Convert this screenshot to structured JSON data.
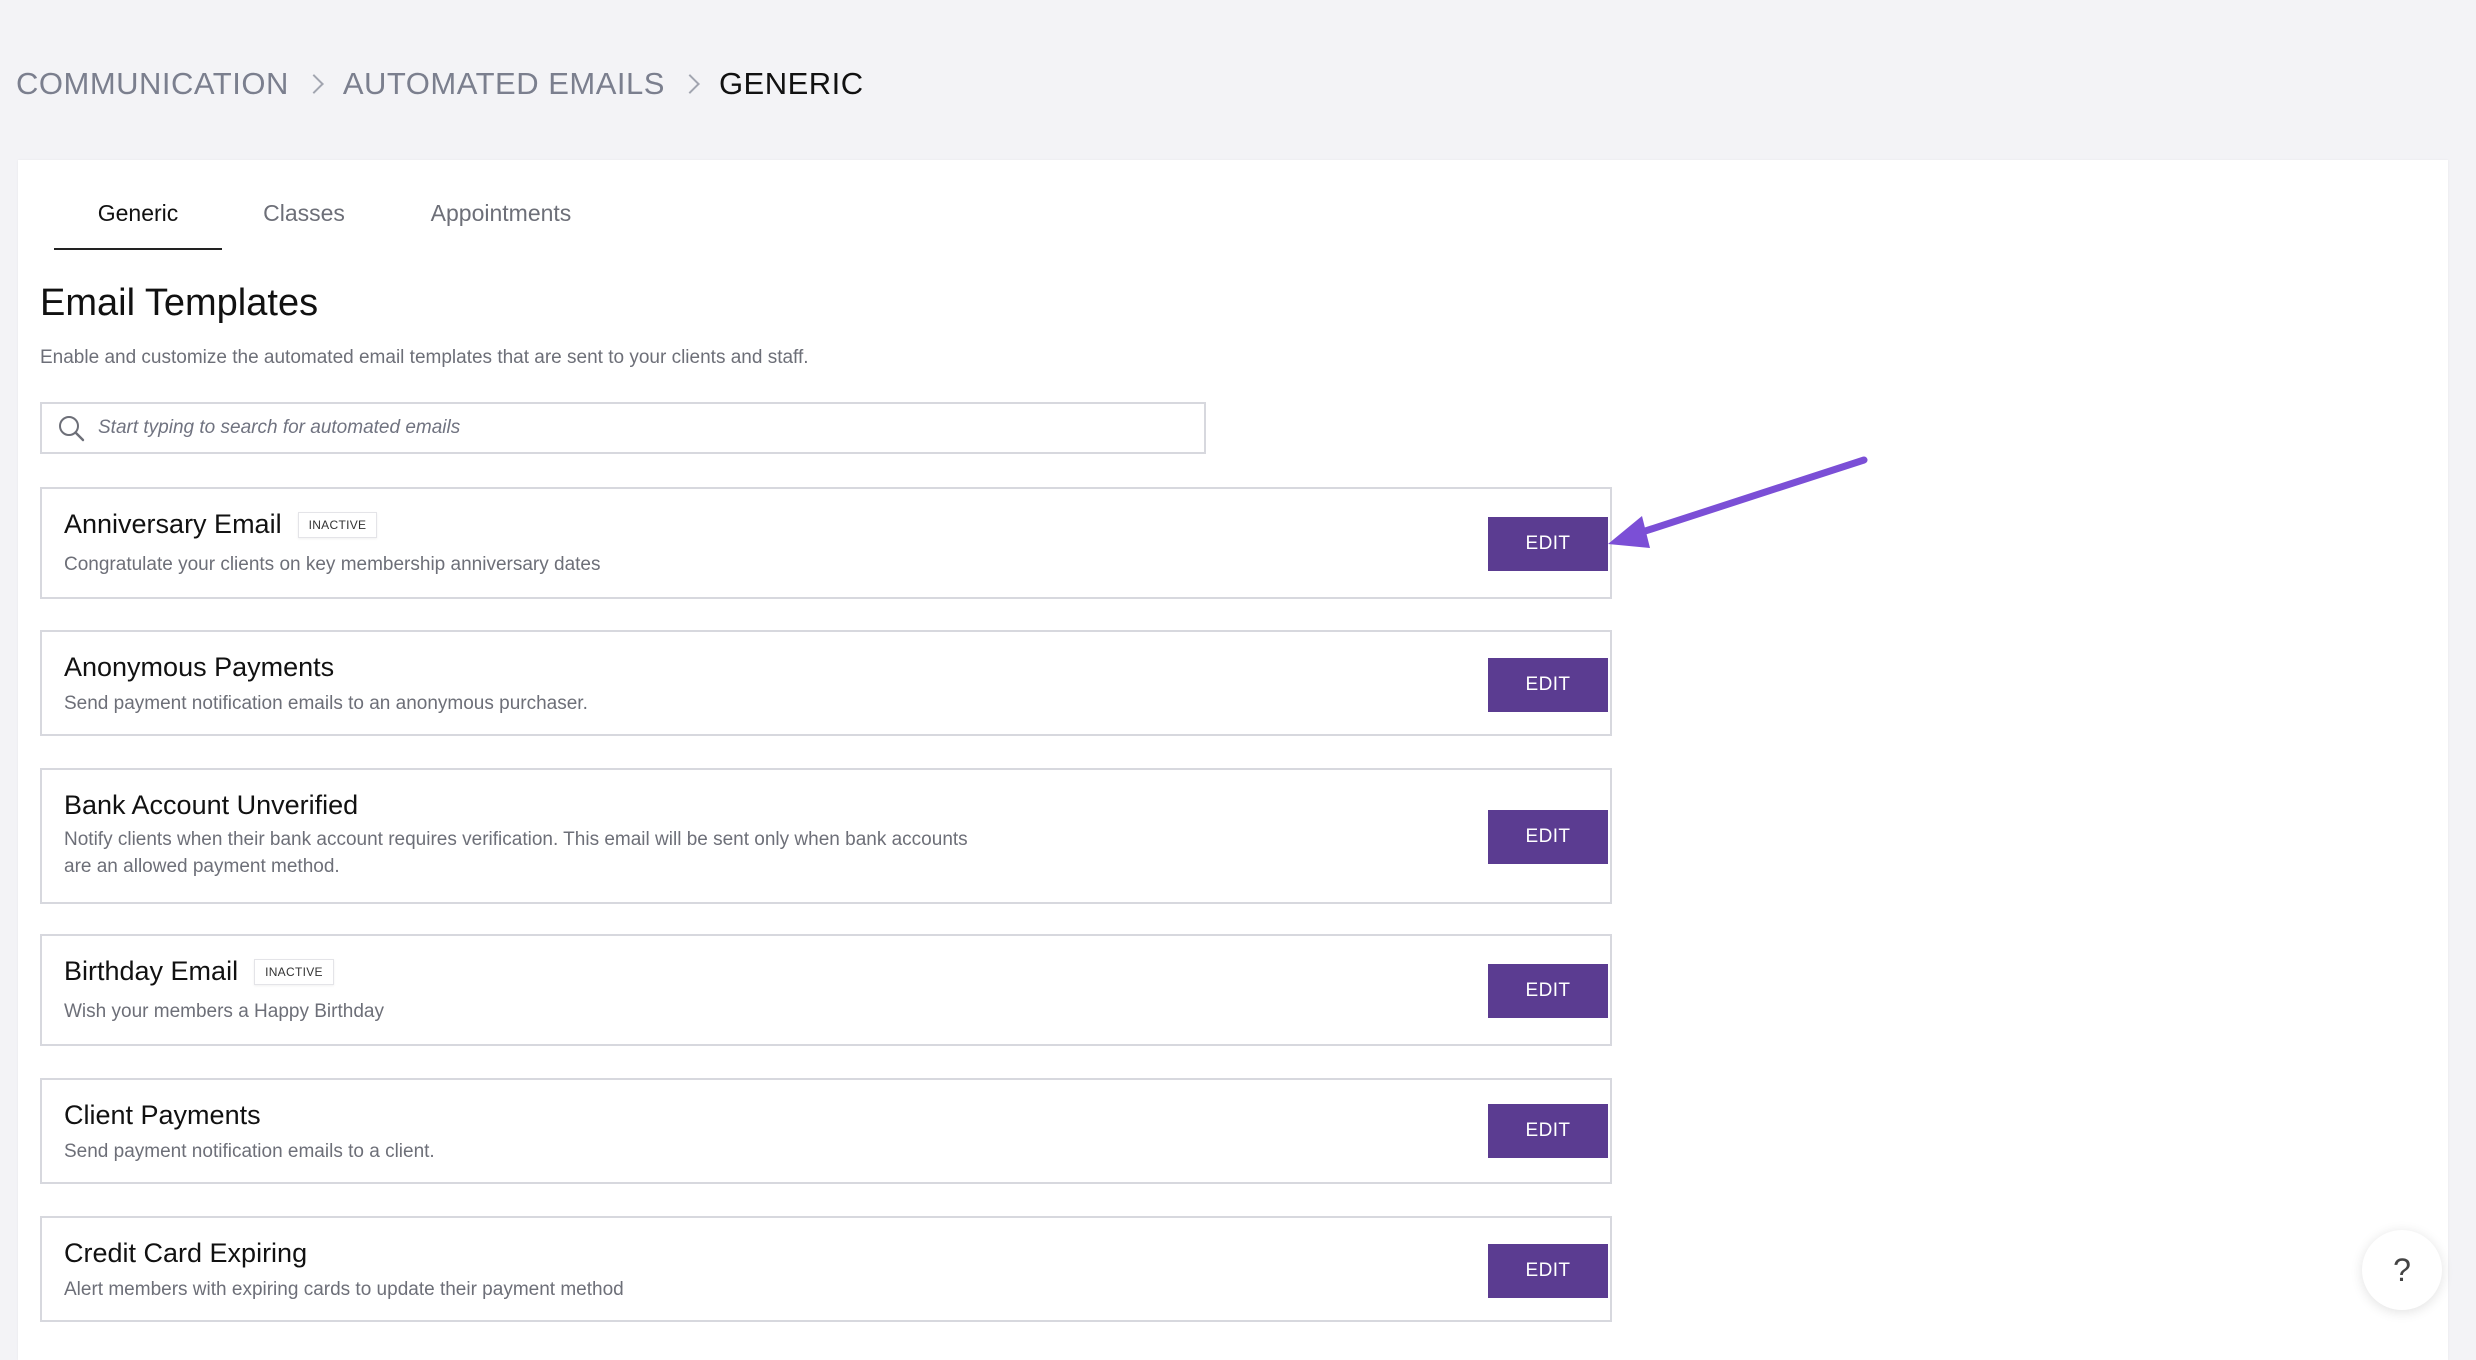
{
  "breadcrumb": {
    "items": [
      "COMMUNICATION",
      "AUTOMATED EMAILS",
      "GENERIC"
    ]
  },
  "tabs": [
    {
      "label": "Generic",
      "active": true
    },
    {
      "label": "Classes",
      "active": false
    },
    {
      "label": "Appointments",
      "active": false
    }
  ],
  "section": {
    "title": "Email Templates",
    "description": "Enable and customize the automated email templates that are sent to your clients and staff."
  },
  "search": {
    "placeholder": "Start typing to search for automated emails",
    "value": ""
  },
  "templates": [
    {
      "name": "Anniversary Email",
      "badge": "INACTIVE",
      "description": "Congratulate your clients on key membership anniversary dates",
      "button": "EDIT"
    },
    {
      "name": "Anonymous Payments",
      "badge": "",
      "description": "Send payment notification emails to an anonymous purchaser.",
      "button": "EDIT"
    },
    {
      "name": "Bank Account Unverified",
      "badge": "",
      "description": "Notify clients when their bank account requires verification. This email will be sent only when bank accounts are an allowed payment method.",
      "button": "EDIT"
    },
    {
      "name": "Birthday Email",
      "badge": "INACTIVE",
      "description": "Wish your members a Happy Birthday",
      "button": "EDIT"
    },
    {
      "name": "Client Payments",
      "badge": "",
      "description": "Send payment notification emails to a client.",
      "button": "EDIT"
    },
    {
      "name": "Credit Card Expiring",
      "badge": "",
      "description": "Alert members with expiring cards to update their payment method",
      "button": "EDIT"
    }
  ],
  "help": {
    "label": "?"
  },
  "colors": {
    "accent": "#5b3c91",
    "annotation_arrow": "#7b4fd6",
    "page_background": "#f3f3f6"
  },
  "icons": {
    "search": "search-icon",
    "breadcrumb_separator": "chevron-right-icon"
  }
}
